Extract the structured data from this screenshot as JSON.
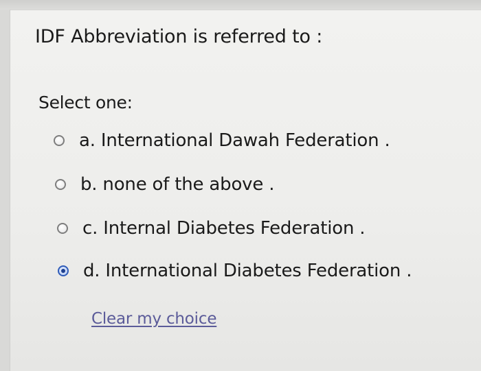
{
  "question": {
    "text": "IDF Abbreviation is referred to :"
  },
  "prompt": "Select one:",
  "options": [
    {
      "label": "a. International Dawah Federation .",
      "selected": false
    },
    {
      "label": "b. none of the above .",
      "selected": false
    },
    {
      "label": "c. Internal Diabetes Federation .",
      "selected": false
    },
    {
      "label": "d. International Diabetes Federation .",
      "selected": true
    }
  ],
  "clear_choice_label": "Clear my choice",
  "colors": {
    "background": "#ededeb",
    "text": "#1a1a1a",
    "link": "#5b5b99",
    "radio_selected": "#2f5bb8"
  }
}
